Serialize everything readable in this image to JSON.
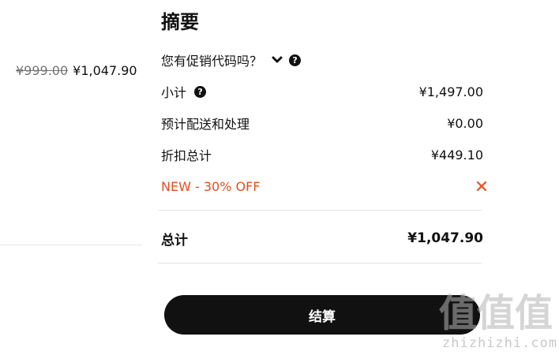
{
  "product": {
    "original_price": "¥999.00",
    "sale_price": "¥1,047.90"
  },
  "summary": {
    "title": "摘要",
    "promo_prompt": "您有促销代码吗？",
    "subtotal_label": "小计",
    "subtotal_value": "¥1,497.00",
    "shipping_label": "预计配送和处理",
    "shipping_value": "¥0.00",
    "discount_label": "折扣总计",
    "discount_value": "¥449.10",
    "promo_code_applied": "NEW - 30% OFF",
    "total_label": "总计",
    "total_value": "¥1,047.90",
    "checkout_label": "结算"
  },
  "watermark": {
    "logo_text": "值值值",
    "site": "zhizhizhi.com"
  },
  "colors": {
    "accent_discount": "#e54e1f",
    "button_bg": "#111111",
    "text": "#111111",
    "muted": "#757575"
  },
  "icons": {
    "help": "question-circle",
    "chevron": "chevron-down",
    "remove": "close-x"
  }
}
